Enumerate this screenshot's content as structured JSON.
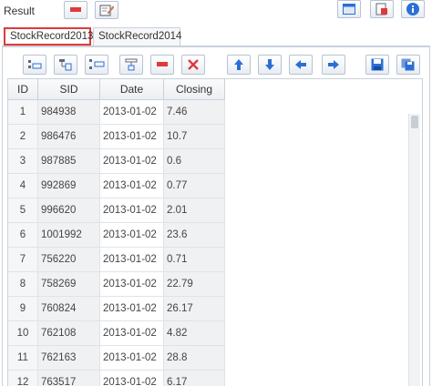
{
  "header": {
    "title": "Result"
  },
  "tabs": [
    {
      "label": "StockRecord2013",
      "active": true
    },
    {
      "label": "StockRecord2014",
      "active": false
    }
  ],
  "table": {
    "columns": [
      "ID",
      "SID",
      "Date",
      "Closing"
    ],
    "rows": [
      [
        "1",
        "984938",
        "2013-01-02",
        "7.46"
      ],
      [
        "2",
        "986476",
        "2013-01-02",
        "10.7"
      ],
      [
        "3",
        "987885",
        "2013-01-02",
        "0.6"
      ],
      [
        "4",
        "992869",
        "2013-01-02",
        "0.77"
      ],
      [
        "5",
        "996620",
        "2013-01-02",
        "2.01"
      ],
      [
        "6",
        "1001992",
        "2013-01-02",
        "23.6"
      ],
      [
        "7",
        "756220",
        "2013-01-02",
        "0.71"
      ],
      [
        "8",
        "758269",
        "2013-01-02",
        "22.79"
      ],
      [
        "9",
        "760824",
        "2013-01-02",
        "26.17"
      ],
      [
        "10",
        "762108",
        "2013-01-02",
        "4.82"
      ],
      [
        "11",
        "762163",
        "2013-01-02",
        "28.8"
      ],
      [
        "12",
        "763517",
        "2013-01-02",
        "6.17"
      ]
    ]
  },
  "colors": {
    "accent_red": "#e0393b",
    "accent_blue": "#2b6fd6",
    "border": "#c9d1da"
  }
}
